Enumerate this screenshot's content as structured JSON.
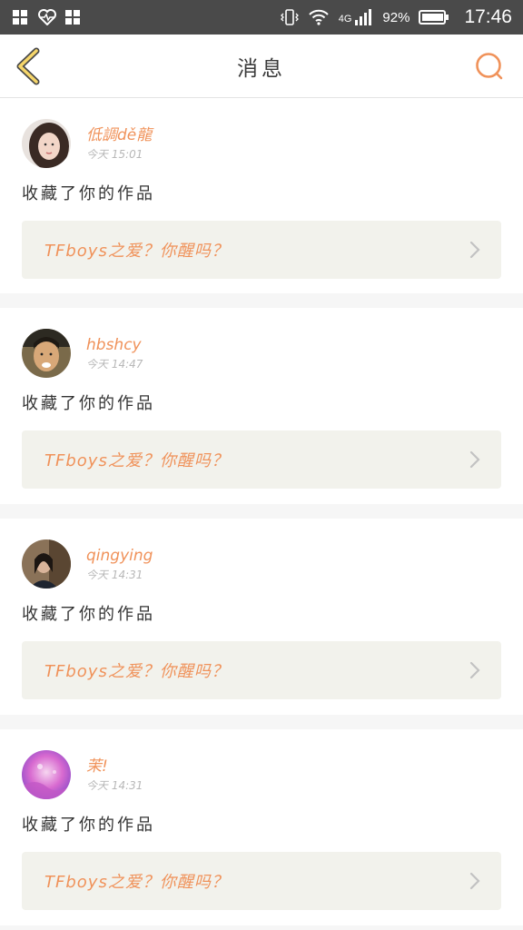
{
  "status_bar": {
    "battery": "92%",
    "network": "4G",
    "time": "17:46",
    "icons_left": [
      "app-grid-icon",
      "heart-rate-icon",
      "app-grid-icon"
    ],
    "icons_right": [
      "vibrate-icon",
      "wifi-icon",
      "signal-icon",
      "battery-icon"
    ]
  },
  "header": {
    "title": "消息",
    "back_icon": "chevron-left-icon",
    "search_icon": "search-icon",
    "accent": "#f0925a",
    "back_color": "#f6d66a"
  },
  "messages": [
    {
      "username": "低調dě龍",
      "time": "今天 15:01",
      "action": "收藏了你的作品",
      "work_title": "TFboys之爱？你醒吗？"
    },
    {
      "username": "hbshcy",
      "time": "今天 14:47",
      "action": "收藏了你的作品",
      "work_title": "TFboys之爱？你醒吗？"
    },
    {
      "username": "qingying",
      "time": "今天 14:31",
      "action": "收藏了你的作品",
      "work_title": "TFboys之爱？你醒吗？"
    },
    {
      "username": "茉!",
      "time": "今天 14:31",
      "action": "收藏了你的作品",
      "work_title": "TFboys之爱？你醒吗？"
    }
  ]
}
